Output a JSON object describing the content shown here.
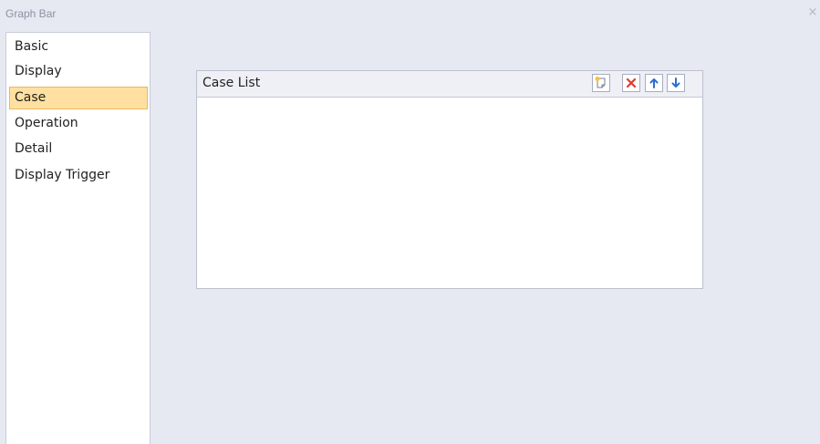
{
  "window": {
    "title": "Graph Bar",
    "close_glyph": "×"
  },
  "sidebar": {
    "items": [
      {
        "label": "Basic",
        "selected": false
      },
      {
        "label": "Display",
        "selected": false
      },
      {
        "label": "Case",
        "selected": true
      },
      {
        "label": "Operation",
        "selected": false
      },
      {
        "label": "Detail",
        "selected": false
      },
      {
        "label": "Display Trigger",
        "selected": false
      }
    ]
  },
  "case_panel": {
    "title": "Case List",
    "toolbar": [
      {
        "icon": "new-item-icon"
      },
      {
        "icon": "delete-icon"
      },
      {
        "icon": "arrow-up-icon"
      },
      {
        "icon": "arrow-down-icon"
      }
    ],
    "rows": []
  },
  "colors": {
    "background": "#e6e8f2",
    "selected_item": "#ffe0a0",
    "delete_icon": "#e03a2e",
    "arrow_icon": "#2b6fd6"
  }
}
